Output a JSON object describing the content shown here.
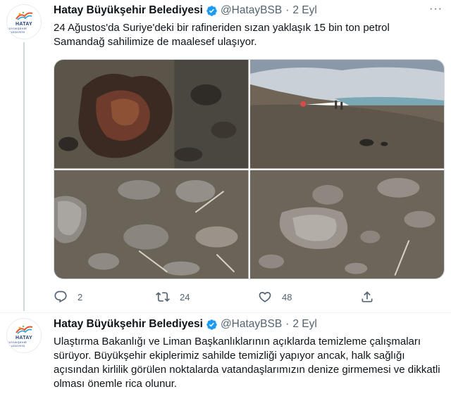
{
  "tweets": [
    {
      "avatar": {
        "logo_text": "HATAY",
        "logo_sub": "BÜYÜKŞEHİR BELEDİYESİ"
      },
      "name": "Hatay Büyükşehir Belediyesi",
      "handle": "@HatayBSB",
      "separator": "·",
      "time": "2 Eyl",
      "more": "···",
      "text": "24 Ağustos'da Suriye'deki bir rafineriden sızan yaklaşık 15 bin ton petrol Samandağ sahilimize de maalesef ulaşıyor.",
      "media_count": 4,
      "actions": {
        "reply": "2",
        "retweet": "24",
        "like": "48"
      }
    },
    {
      "avatar": {
        "logo_text": "HATAY",
        "logo_sub": "BÜYÜKŞEHİR BELEDİYESİ"
      },
      "name": "Hatay Büyükşehir Belediyesi",
      "handle": "@HatayBSB",
      "separator": "·",
      "time": "2 Eyl",
      "text": "Ulaştırma Bakanlığı ve Liman Başkanlıklarının açıklarda temizleme çalışmaları sürüyor. Büyükşehir ekiplerimiz sahilde temizliği yapıyor ancak, halk sağlığı açısından kirlilik görülen noktalarda vatandaşlarımızın denize girmemesi ve dikkatli olması önemle rica olunur."
    }
  ],
  "colors": {
    "accent": "#1d9bf0",
    "muted": "#536471",
    "text": "#0f1419"
  },
  "icons": {
    "verified": "verified-badge-icon",
    "reply": "reply-icon",
    "retweet": "retweet-icon",
    "like": "heart-icon",
    "share": "share-icon",
    "more": "more-icon"
  }
}
